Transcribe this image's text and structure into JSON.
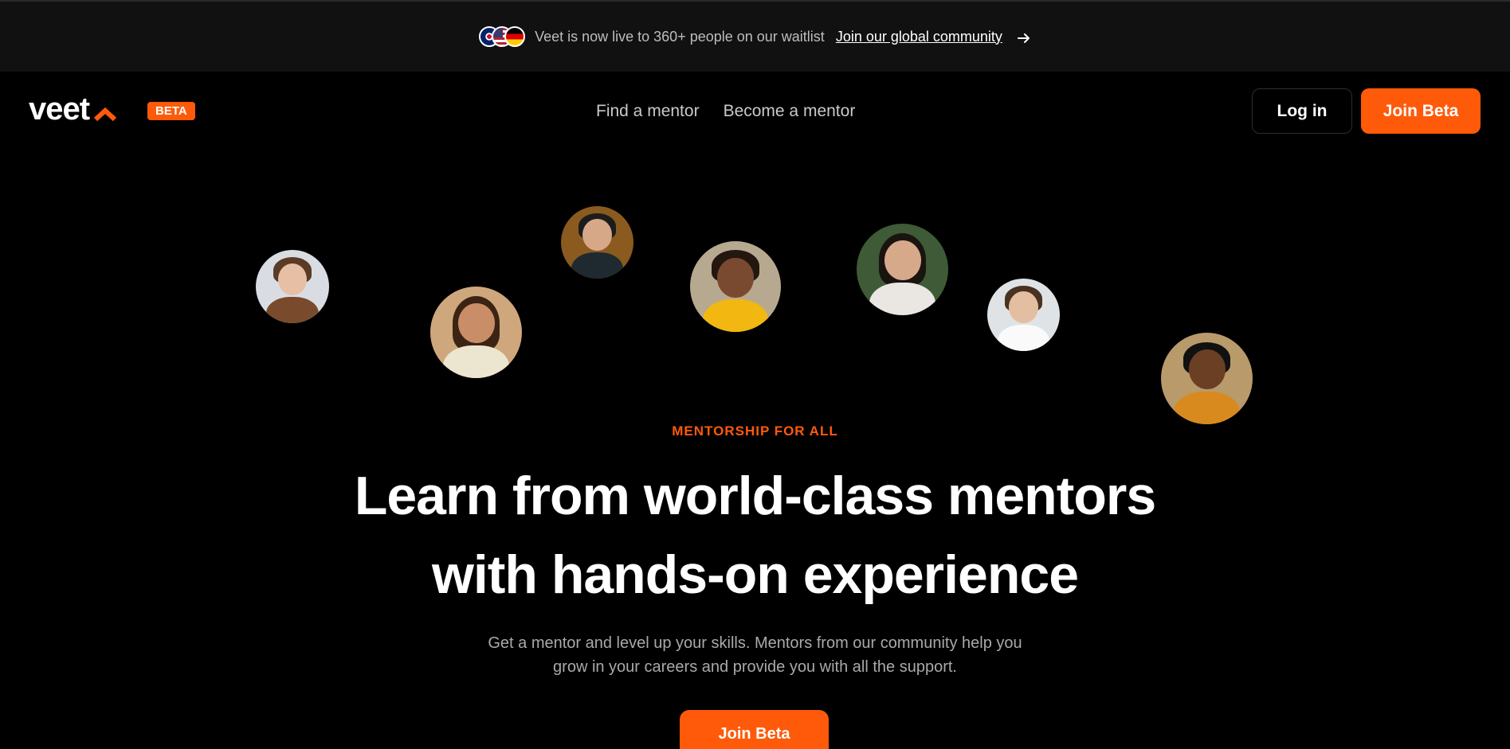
{
  "announcement": {
    "flags": [
      "uk-flag",
      "us-flag",
      "germany-flag"
    ],
    "text": "Veet is now live to 360+ people on our waitlist",
    "link_text": "Join our global community",
    "arrow_icon": "arrow-right-icon"
  },
  "nav": {
    "logo_text": "veet",
    "badge": "BETA",
    "links": [
      "Find a mentor",
      "Become a mentor"
    ],
    "login_label": "Log in",
    "join_label": "Join Beta"
  },
  "hero": {
    "eyebrow": "MENTORSHIP FOR ALL",
    "headline_line1": "Learn from world-class mentors",
    "headline_line2": "with hands-on experience",
    "subtext": "Get a mentor and level up your skills. Mentors from our community help you grow in your careers and provide you with all the support.",
    "cta_label": "Join Beta"
  },
  "colors": {
    "accent": "#ff5a0a",
    "background": "#000000",
    "banner": "#111111"
  }
}
